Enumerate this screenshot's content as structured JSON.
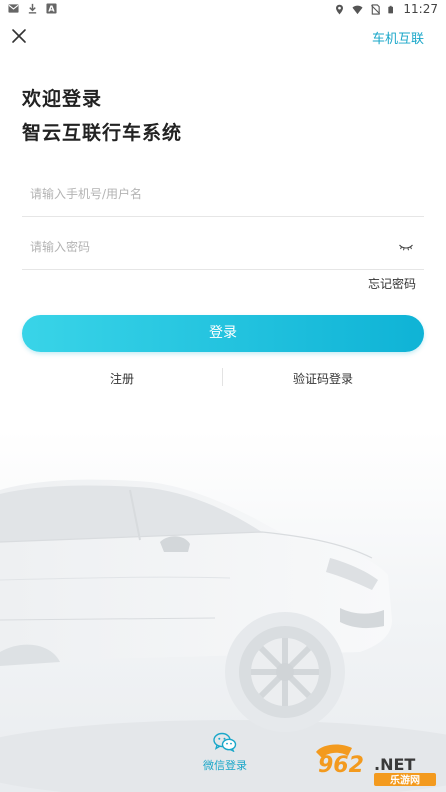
{
  "status_bar": {
    "time": "11:27",
    "left_icons": [
      "mail-icon",
      "download-icon",
      "a-box-icon"
    ],
    "right_icons": [
      "location-icon",
      "wifi-icon",
      "no-sim-icon",
      "battery-icon"
    ]
  },
  "header": {
    "close_icon": "close-icon",
    "right_link": "车机互联"
  },
  "welcome": {
    "line1": "欢迎登录",
    "line2": "智云互联行车系统"
  },
  "form": {
    "username_placeholder": "请输入手机号/用户名",
    "password_placeholder": "请输入密码",
    "username_value": "",
    "password_value": "",
    "eye_icon": "eye-closed-icon",
    "forgot_label": "忘记密码",
    "login_label": "登录"
  },
  "links": {
    "register": "注册",
    "code_login": "验证码登录"
  },
  "wechat": {
    "icon": "wechat-icon",
    "label": "微信登录"
  },
  "watermark": {
    "brand": "962.NET",
    "sub": "乐游网"
  },
  "colors": {
    "accent": "#1aa7c9",
    "button_start": "#39d4e8",
    "button_end": "#0fb3d6",
    "watermark_orange": "#f39a1e"
  }
}
